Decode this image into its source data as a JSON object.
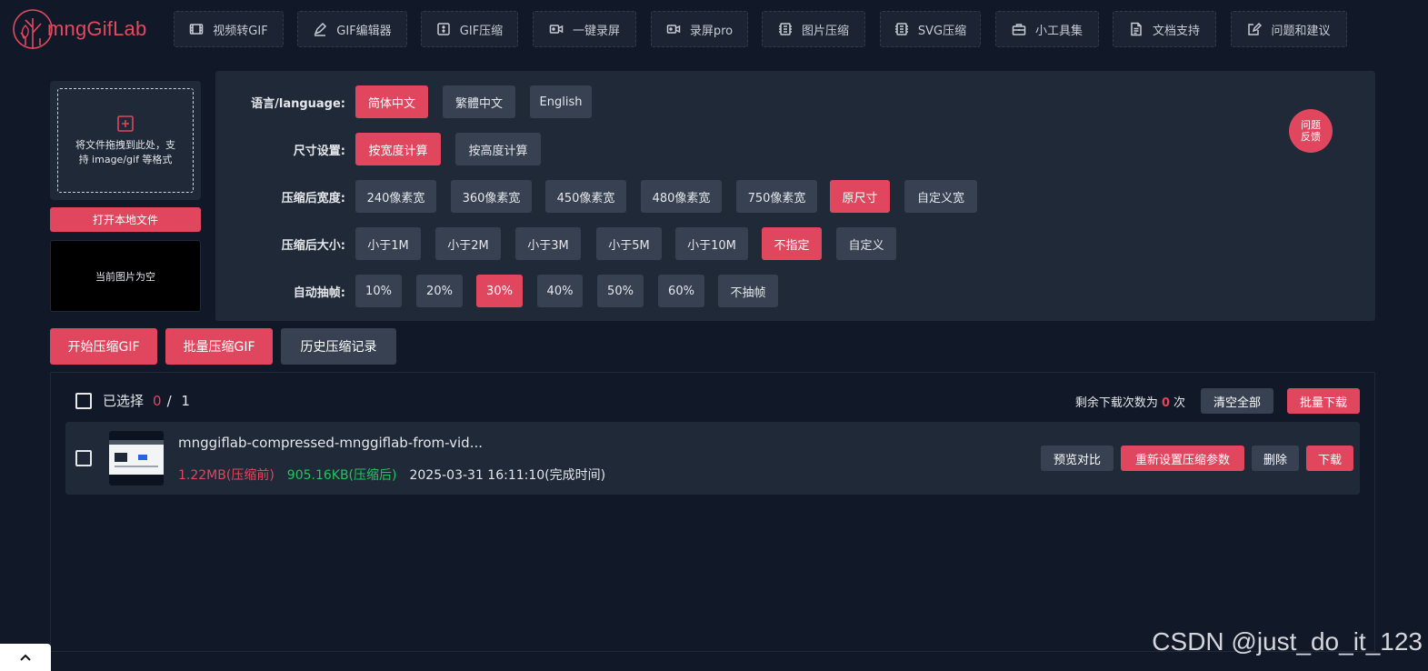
{
  "brand": {
    "logo_text": "mngGifLab",
    "accent": "#e0475f"
  },
  "nav": [
    {
      "label": "视频转GIF",
      "icon": "film-icon"
    },
    {
      "label": "GIF编辑器",
      "icon": "pen-icon"
    },
    {
      "label": "GIF压缩",
      "icon": "compress-icon"
    },
    {
      "label": "一键录屏",
      "icon": "camera-icon"
    },
    {
      "label": "录屏pro",
      "icon": "camera-pro-icon"
    },
    {
      "label": "图片压缩",
      "icon": "image-compress-icon"
    },
    {
      "label": "SVG压缩",
      "icon": "svg-compress-icon"
    },
    {
      "label": "小工具集",
      "icon": "toolbox-icon"
    },
    {
      "label": "文档支持",
      "icon": "document-icon"
    },
    {
      "label": "问题和建议",
      "icon": "edit-icon"
    }
  ],
  "upload": {
    "drop_text": "将文件拖拽到此处，支持 image/gif 等格式",
    "open_button": "打开本地文件",
    "preview_empty": "当前图片为空"
  },
  "settings": {
    "language": {
      "label": "语言/language:",
      "options": [
        "简体中文",
        "繁體中文",
        "English"
      ],
      "selected": "简体中文"
    },
    "size_mode": {
      "label": "尺寸设置:",
      "options": [
        "按宽度计算",
        "按高度计算"
      ],
      "selected": "按宽度计算"
    },
    "width": {
      "label": "压缩后宽度:",
      "options": [
        "240像素宽",
        "360像素宽",
        "450像素宽",
        "480像素宽",
        "750像素宽",
        "原尺寸",
        "自定义宽"
      ],
      "selected": "原尺寸"
    },
    "max_size": {
      "label": "压缩后大小:",
      "options": [
        "小于1M",
        "小于2M",
        "小于3M",
        "小于5M",
        "小于10M",
        "不指定",
        "自定义"
      ],
      "selected": "不指定"
    },
    "frame_drop": {
      "label": "自动抽帧:",
      "options": [
        "10%",
        "20%",
        "30%",
        "40%",
        "50%",
        "60%",
        "不抽帧"
      ],
      "selected": "30%"
    },
    "feedback": "问题反馈"
  },
  "actions": {
    "start": "开始压缩GIF",
    "batch": "批量压缩GIF",
    "history": "历史压缩记录"
  },
  "list": {
    "selected_label": "已选择",
    "selected_count": "0",
    "separator": "/",
    "total": "1",
    "remaining_prefix": "剩余下载次数为",
    "remaining_count": "0",
    "remaining_suffix": "次",
    "clear_all": "清空全部",
    "batch_download": "批量下载",
    "items": [
      {
        "filename": "mnggiflab-compressed-mnggiflab-from-vid...",
        "size_before": "1.22MB(压缩前)",
        "size_after": "905.16KB(压缩后)",
        "completed": "2025-03-31 16:11:10(完成时间)",
        "buttons": {
          "preview": "预览对比",
          "reset": "重新设置压缩参数",
          "delete": "删除",
          "download": "下载"
        }
      }
    ]
  },
  "watermark": "CSDN @just_do_it_123"
}
